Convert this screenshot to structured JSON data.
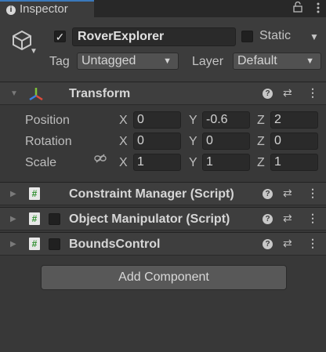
{
  "tab": {
    "title": "Inspector",
    "info_glyph": "i"
  },
  "gameobject": {
    "name": "RoverExplorer",
    "active": true,
    "static_label": "Static",
    "tag_label": "Tag",
    "tag_value": "Untagged",
    "layer_label": "Layer",
    "layer_value": "Default"
  },
  "transform": {
    "title": "Transform",
    "rows": [
      {
        "label": "Position",
        "x": "0",
        "y": "-0.6",
        "z": "2"
      },
      {
        "label": "Rotation",
        "x": "0",
        "y": "0",
        "z": "0"
      },
      {
        "label": "Scale",
        "x": "1",
        "y": "1",
        "z": "1"
      }
    ],
    "axis_labels": {
      "x": "X",
      "y": "Y",
      "z": "Z"
    }
  },
  "components": [
    {
      "title": "Constraint Manager (Script)",
      "has_checkbox": false
    },
    {
      "title": "Object Manipulator (Script)",
      "has_checkbox": true
    },
    {
      "title": "BoundsControl",
      "has_checkbox": true
    }
  ],
  "add_component_label": "Add Component",
  "icons": {
    "tab": "info-icon",
    "gameobject": "cube-icon",
    "transform": "transform-axes-icon",
    "script": "script-hash-icon",
    "help": "help-icon",
    "presets": "presets-icon",
    "more": "kebab-menu-icon",
    "link": "constrain-proportions-icon"
  },
  "colors": {
    "background": "#383838",
    "header": "#3c3c3c",
    "accent_tab": "#3a79bb",
    "script_green": "#2f8f2f"
  }
}
